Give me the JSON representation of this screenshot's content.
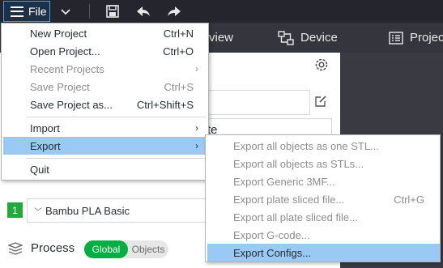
{
  "toolbar": {
    "file_label": "File",
    "icons": [
      "hamburger-icon",
      "chevron-down-icon",
      "save-icon",
      "undo-icon",
      "redo-icon"
    ]
  },
  "tabs": [
    {
      "label": "view",
      "icon": "preview-icon"
    },
    {
      "label": "Device",
      "icon": "device-icon"
    },
    {
      "label": "Projec",
      "icon": "project-icon"
    }
  ],
  "sidebar": {
    "field2_partial_text": "te",
    "filament": {
      "index": "1",
      "preset": "Bambu PLA Basic"
    },
    "process": {
      "label": "Process",
      "toggle_on": "Global",
      "toggle_off": "Objects"
    }
  },
  "file_menu": {
    "items": [
      {
        "label": "New Project",
        "shortcut": "Ctrl+N"
      },
      {
        "label": "Open Project...",
        "shortcut": "Ctrl+O"
      },
      {
        "label": "Recent Projects",
        "shortcut": "",
        "arrow": "›"
      },
      {
        "label": "Save Project",
        "shortcut": "Ctrl+S"
      },
      {
        "label": "Save Project as...",
        "shortcut": "Ctrl+Shift+S"
      },
      {
        "label": "Import",
        "shortcut": "",
        "arrow": "›"
      },
      {
        "label": "Export",
        "shortcut": "",
        "arrow": "›"
      },
      {
        "label": "Quit",
        "shortcut": ""
      }
    ]
  },
  "export_submenu": {
    "items": [
      {
        "label": "Export all objects as one STL...",
        "shortcut": ""
      },
      {
        "label": "Export all objects as STLs...",
        "shortcut": ""
      },
      {
        "label": "Export Generic 3MF...",
        "shortcut": ""
      },
      {
        "label": "Export plate sliced file...",
        "shortcut": "Ctrl+G"
      },
      {
        "label": "Export all plate sliced file...",
        "shortcut": ""
      },
      {
        "label": "Export G-code...",
        "shortcut": ""
      },
      {
        "label": "Export Configs...",
        "shortcut": ""
      }
    ]
  },
  "colors": {
    "accent_green": "#00ae42",
    "menu_highlight": "#99c9f4",
    "toolbar_bg": "#25262d"
  }
}
